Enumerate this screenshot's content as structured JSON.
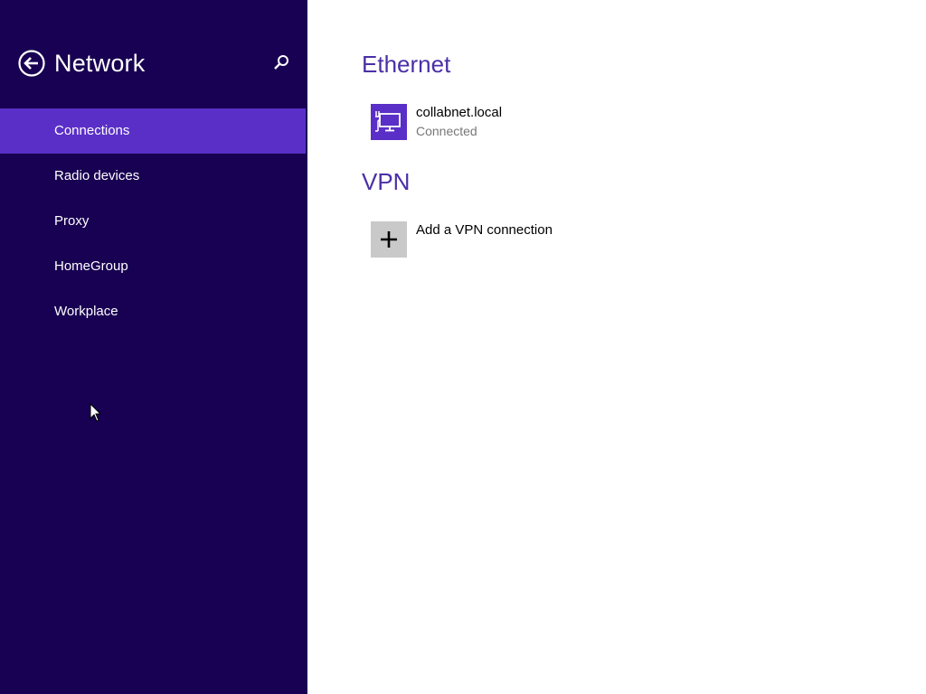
{
  "sidebar": {
    "title": "Network",
    "back_icon": "back-arrow-icon",
    "search_icon": "search-icon",
    "items": [
      {
        "label": "Connections",
        "selected": true
      },
      {
        "label": "Radio devices",
        "selected": false
      },
      {
        "label": "Proxy",
        "selected": false
      },
      {
        "label": "HomeGroup",
        "selected": false
      },
      {
        "label": "Workplace",
        "selected": false
      }
    ]
  },
  "main": {
    "ethernet": {
      "heading": "Ethernet",
      "connection": {
        "name": "collabnet.local",
        "status": "Connected",
        "icon": "ethernet-network-icon"
      }
    },
    "vpn": {
      "heading": "VPN",
      "add_label": "Add a VPN connection",
      "add_icon": "plus-icon"
    }
  },
  "colors": {
    "sidebar_bg": "#180052",
    "selected_bg": "#5a2fc7",
    "heading": "#4a30a6",
    "add_tile": "#c9c9c9"
  }
}
